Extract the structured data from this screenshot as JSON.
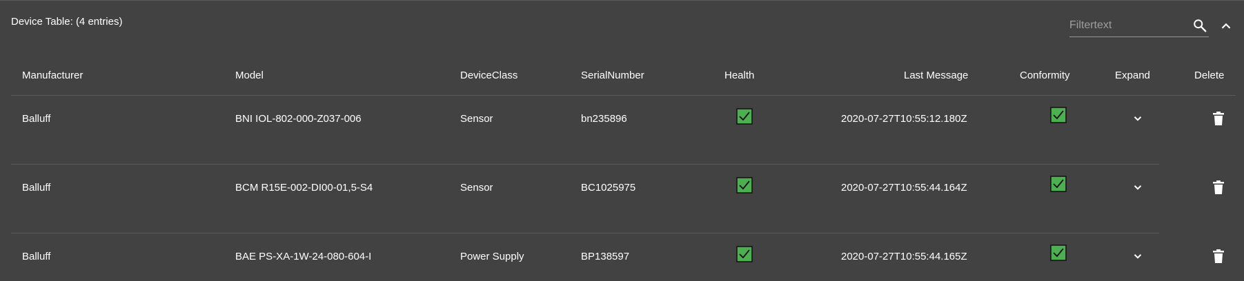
{
  "title": "Device Table: (4 entries)",
  "filter": {
    "placeholder": "Filtertext",
    "value": ""
  },
  "icons": {
    "search": "search-icon",
    "collapse": "chevron-up-icon",
    "expand": "chevron-down-icon",
    "delete": "trash-icon",
    "check": "checkbox-checked-icon"
  },
  "colors": {
    "background": "#424242",
    "check_fill": "#4caf50",
    "divider": "#5a5a5a"
  },
  "columns": {
    "manufacturer": "Manufacturer",
    "model": "Model",
    "device_class": "DeviceClass",
    "serial": "SerialNumber",
    "health": "Health",
    "last_message": "Last Message",
    "conformity": "Conformity",
    "expand": "Expand",
    "delete": "Delete"
  },
  "rows": [
    {
      "manufacturer": "Balluff",
      "model": "BNI IOL-802-000-Z037-006",
      "device_class": "Sensor",
      "serial": "bn235896",
      "health": true,
      "last_message": "2020-07-27T10:55:12.180Z",
      "conformity": true
    },
    {
      "manufacturer": "Balluff",
      "model": "BCM R15E-002-DI00-01,5-S4",
      "device_class": "Sensor",
      "serial": "BC1025975",
      "health": true,
      "last_message": "2020-07-27T10:55:44.164Z",
      "conformity": true
    },
    {
      "manufacturer": "Balluff",
      "model": "BAE PS-XA-1W-24-080-604-I",
      "device_class": "Power Supply",
      "serial": "BP138597",
      "health": true,
      "last_message": "2020-07-27T10:55:44.165Z",
      "conformity": true
    }
  ]
}
